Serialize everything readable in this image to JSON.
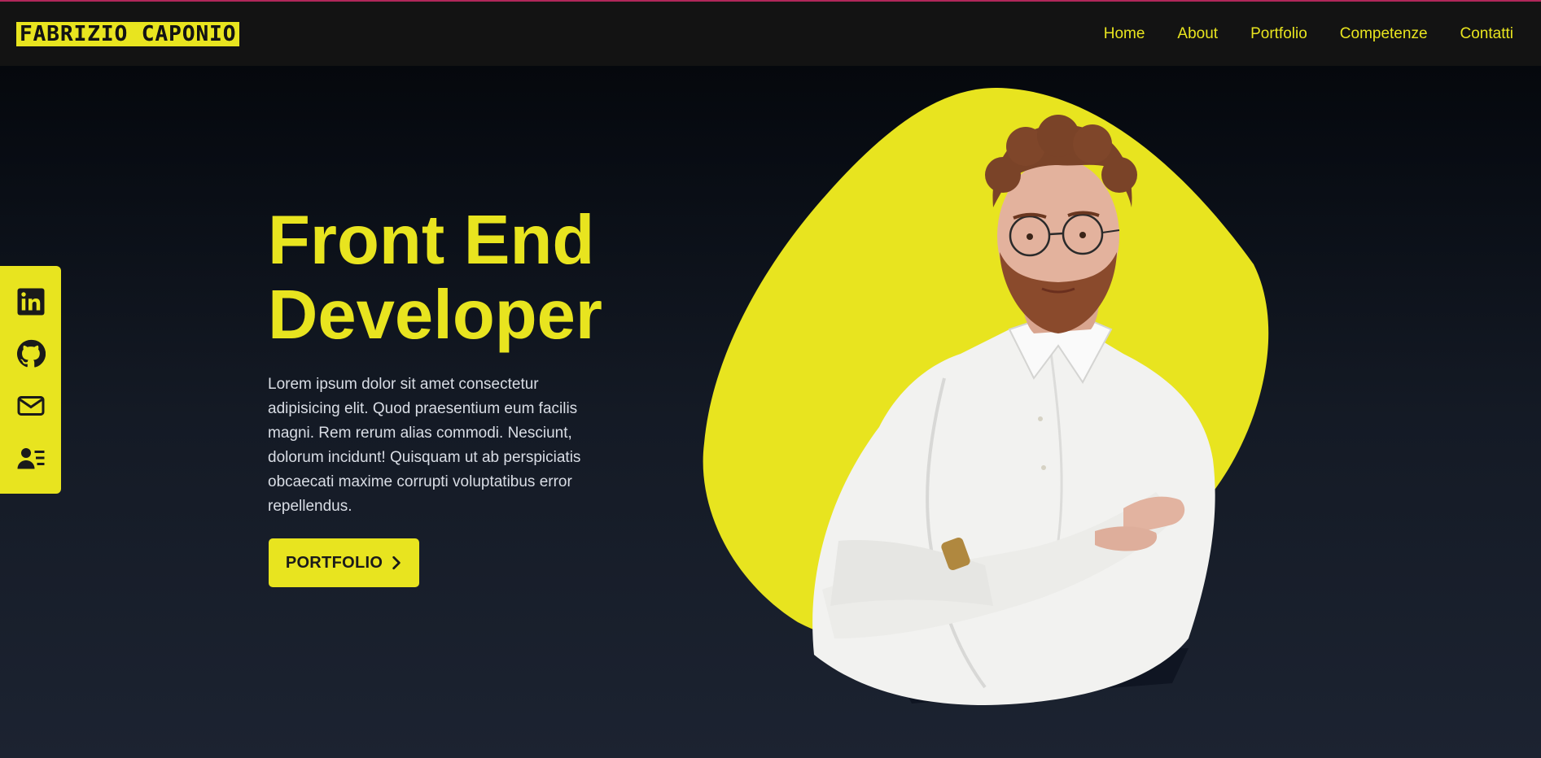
{
  "logo": {
    "text": "FABRIZIO CAPONIO"
  },
  "nav": {
    "items": [
      {
        "label": "Home"
      },
      {
        "label": "About"
      },
      {
        "label": "Portfolio"
      },
      {
        "label": "Competenze"
      },
      {
        "label": "Contatti"
      }
    ]
  },
  "social": {
    "items": [
      {
        "icon": "linkedin-icon"
      },
      {
        "icon": "github-icon"
      },
      {
        "icon": "mail-icon"
      },
      {
        "icon": "contact-card-icon"
      }
    ]
  },
  "hero": {
    "title_line1": "Front End",
    "title_line2": "Developer",
    "description": "Lorem ipsum dolor sit amet consectetur adipisicing elit. Quod praesentium eum facilis magni. Rem rerum alias commodi. Nesciunt, dolorum incidunt! Quisquam ut ab perspiciatis obcaecati maxime corrupti voluptatibus error repellendus.",
    "cta_label": "PORTFOLIO"
  },
  "colors": {
    "accent": "#e8e41f",
    "navbar_bg": "#131313",
    "page_bg_top": "#030508",
    "page_bg_bottom": "#1c2331",
    "text_light": "#d9dde5"
  }
}
